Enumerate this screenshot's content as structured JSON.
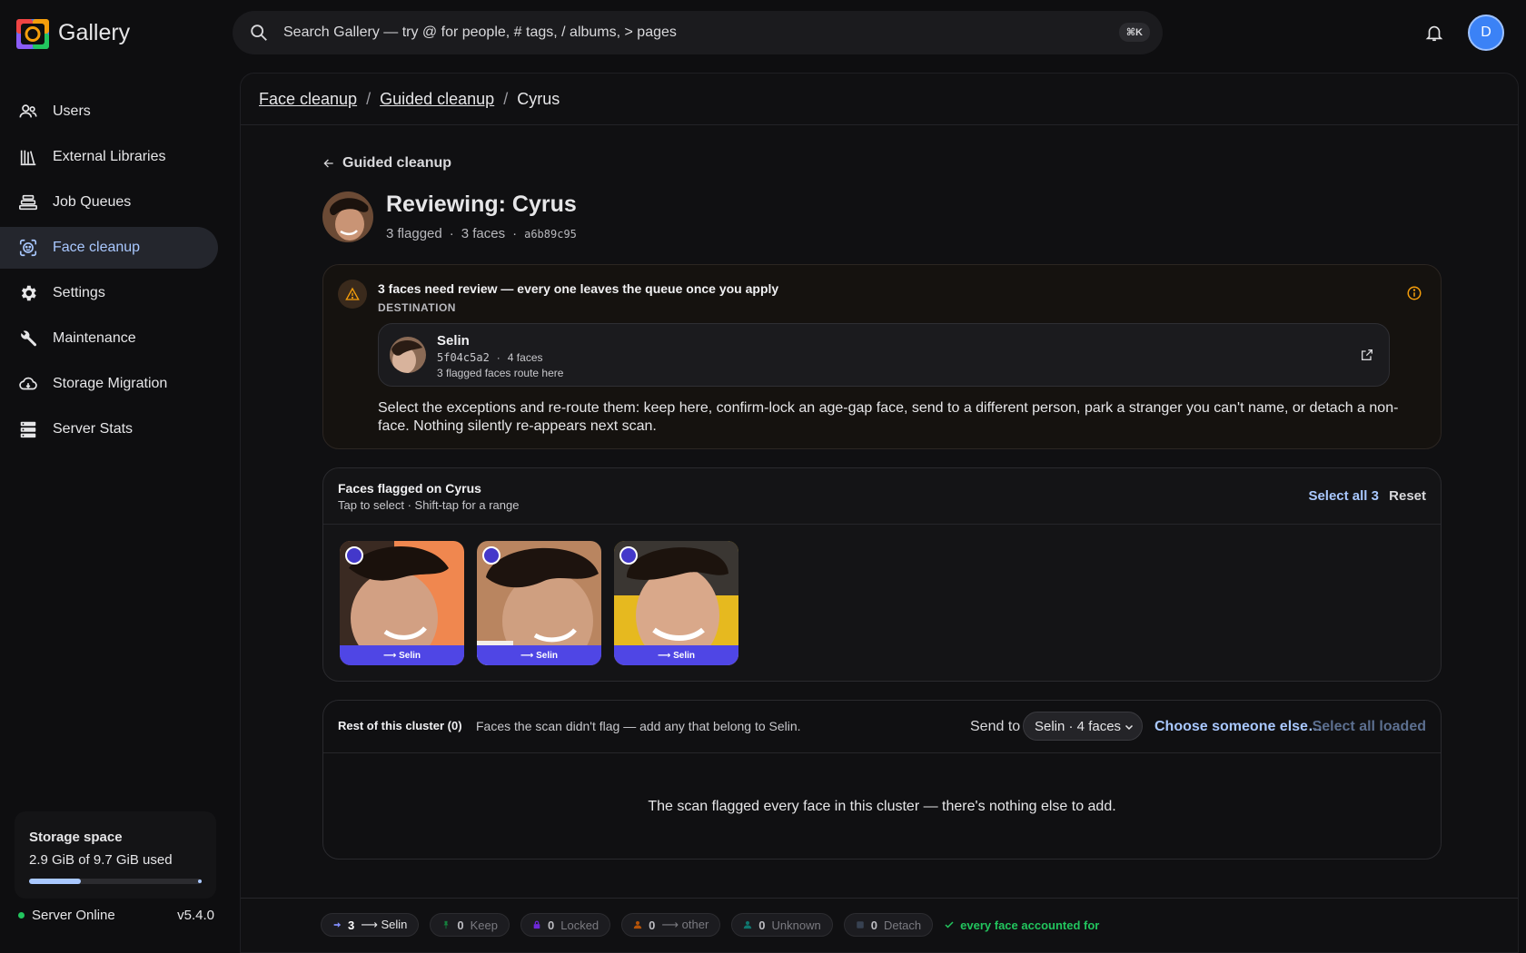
{
  "app": {
    "name": "Gallery"
  },
  "search": {
    "placeholder": "Search Gallery — try @ for people, # tags, / albums, > pages",
    "shortcut": "⌘K"
  },
  "user": {
    "initial": "D"
  },
  "sidebar": {
    "items": [
      {
        "label": "Users",
        "icon": "users-icon"
      },
      {
        "label": "External Libraries",
        "icon": "library-icon"
      },
      {
        "label": "Job Queues",
        "icon": "queue-icon"
      },
      {
        "label": "Face cleanup",
        "icon": "face-scan-icon",
        "active": true
      },
      {
        "label": "Settings",
        "icon": "gear-icon"
      },
      {
        "label": "Maintenance",
        "icon": "wrench-icon"
      },
      {
        "label": "Storage Migration",
        "icon": "cloud-icon"
      },
      {
        "label": "Server Stats",
        "icon": "server-icon"
      }
    ],
    "storage": {
      "title": "Storage space",
      "text": "2.9 GiB of 9.7 GiB used",
      "used_fraction": 0.3
    },
    "server": {
      "status": "Server Online",
      "version": "v5.4.0"
    }
  },
  "breadcrumb": [
    "Face cleanup",
    "Guided cleanup",
    "Cyrus"
  ],
  "review": {
    "back_label": "Guided cleanup",
    "title": "Reviewing: Cyrus",
    "flagged": "3 flagged",
    "faces": "3 faces",
    "id": "a6b89c95"
  },
  "warning": {
    "title": "3 faces need review — every one leaves the queue once you apply",
    "destination_label": "DESTINATION",
    "destination": {
      "name": "Selin",
      "id": "5f04c5a2",
      "faces": "4 faces",
      "route": "3 flagged faces route here"
    },
    "description": "Select the exceptions and re-route them: keep here, confirm-lock an age-gap face, send to a different person, park a stranger you can't name, or detach a non-face. Nothing silently re-appears next scan."
  },
  "flagged": {
    "title": "Faces flagged on Cyrus",
    "subtitle": "Tap to select · Shift-tap for a range",
    "select_all": "Select all 3",
    "reset": "Reset",
    "faces": [
      {
        "route": "⟶ Selin"
      },
      {
        "route": "⟶ Selin"
      },
      {
        "route": "⟶ Selin"
      }
    ]
  },
  "rest": {
    "title": "Rest of this cluster (0)",
    "subtitle": "Faces the scan didn't flag — add any that belong to Selin.",
    "send_to": "Send to",
    "target": "Selin · 4 faces",
    "choose": "Choose someone else…",
    "select_loaded": "Select all loaded",
    "empty": "The scan flagged every face in this cluster — there's nothing else to add."
  },
  "footer": {
    "chips": [
      {
        "count": "3",
        "label": "⟶ Selin",
        "active": true
      },
      {
        "count": "0",
        "label": "Keep"
      },
      {
        "count": "0",
        "label": "Locked"
      },
      {
        "count": "0",
        "label": "⟶ other"
      },
      {
        "count": "0",
        "label": "Unknown"
      },
      {
        "count": "0",
        "label": "Detach"
      }
    ],
    "status": "every face accounted for"
  },
  "colors": {
    "accent": "#a9c8ff",
    "route": "#4f46e5",
    "success": "#22c55e",
    "warning": "#f59e0b"
  }
}
